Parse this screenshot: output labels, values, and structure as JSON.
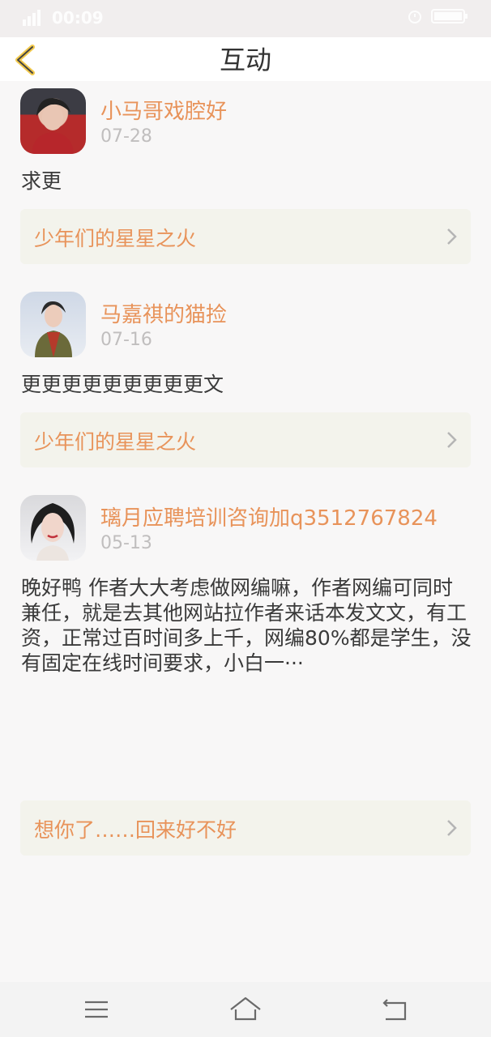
{
  "status": {
    "time": "00:09"
  },
  "header": {
    "title": "互动"
  },
  "posts": [
    {
      "username": "小马哥戏腔好",
      "date": "07-28",
      "text": "求更",
      "book": "少年们的星星之火"
    },
    {
      "username": "马嘉祺的猫捡",
      "date": "07-16",
      "text": "更更更更更更更更更文",
      "book": "少年们的星星之火"
    },
    {
      "username": "璃月应聘培训咨询加q3512767824",
      "date": "05-13",
      "text": "晚好鸭 作者大大考虑做网编嘛，作者网编可同时兼任，就是去其他网站拉作者来话本发文文，有工资，正常过百时间多上千，网编80%都是学生，没有固定在线时间要求，小白一···",
      "book": "想你了……回来好不好"
    }
  ],
  "colors": {
    "accent": "#e8935a",
    "card_bg": "#f3f3ec",
    "page_bg": "#f8f7f7"
  },
  "icons": [
    "signal-icon",
    "alarm-icon",
    "battery-icon",
    "back-arrow-icon",
    "chevron-right-icon",
    "menu-icon",
    "home-icon",
    "return-icon"
  ]
}
